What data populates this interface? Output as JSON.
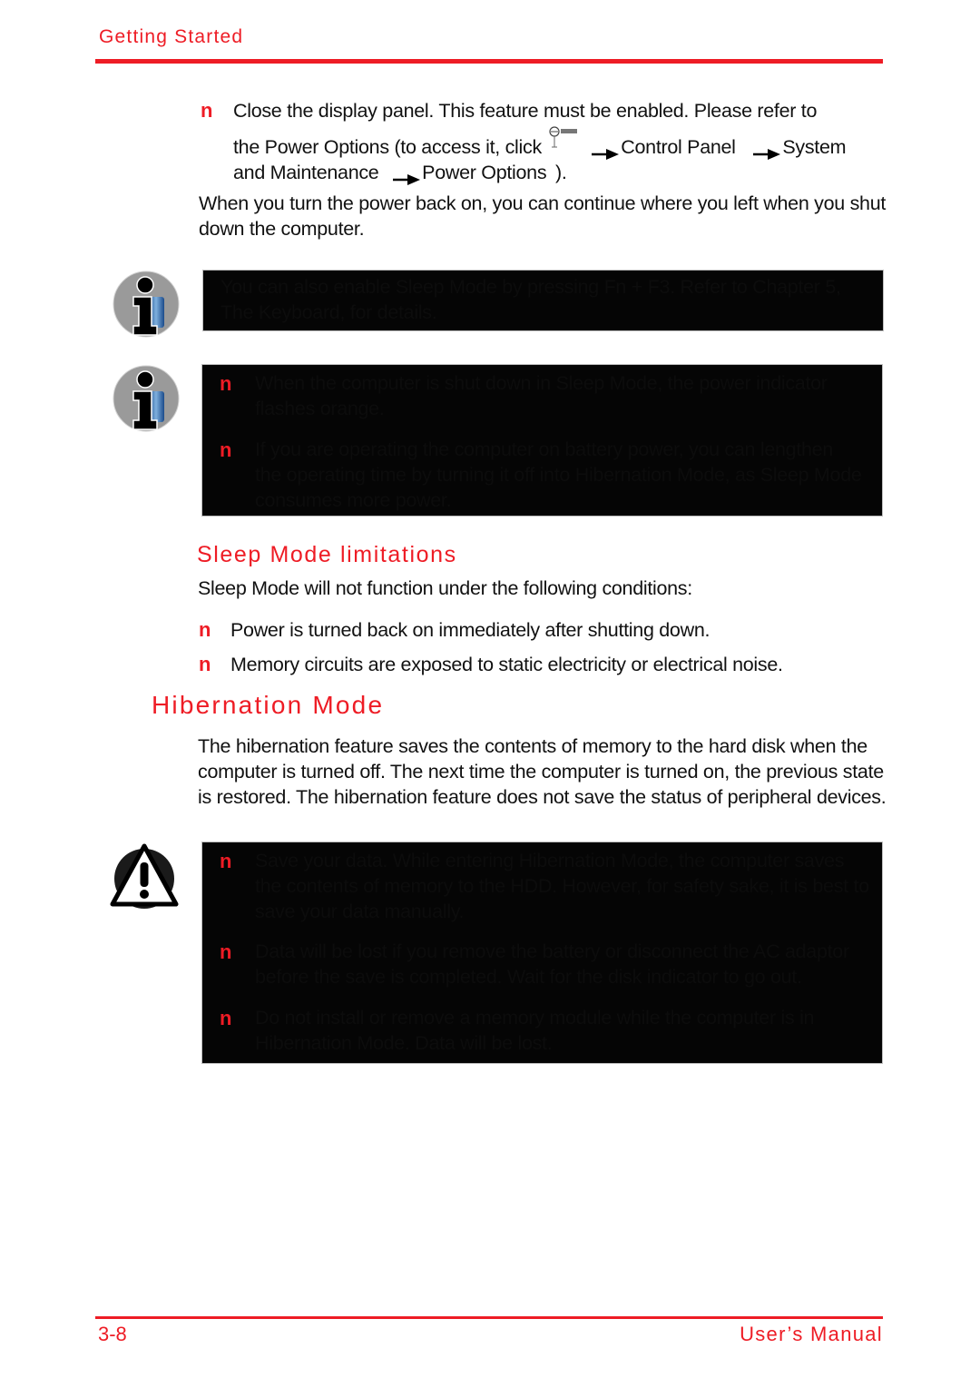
{
  "header": {
    "section_title": "Getting Started"
  },
  "top_bullet": {
    "line1": "Close the display panel. This feature must be enabled. Please refer to",
    "line2_prefix": "the Power Options (to access it, click",
    "start_icon": "windows-start-icon",
    "step1": "Control Panel",
    "step2": "System",
    "line3_prefix": "and Maintenance",
    "step3": "Power Options",
    "line3_suffix": ")."
  },
  "resume_paragraph": {
    "line1": "When you turn the power back on, you can continue where you left when you shut",
    "line2": "down the computer."
  },
  "note1": {
    "icon": "info-icon",
    "lines": [
      "You can also enable Sleep Mode by pressing Fn + F3. Refer to Chapter 5,",
      "The Keyboard, for details."
    ]
  },
  "note2": {
    "icon": "info-icon",
    "items": [
      {
        "lines": [
          "When the computer is shut down in Sleep Mode, the power indicator",
          "flashes orange."
        ]
      },
      {
        "lines": [
          "If you are operating the computer on battery power, you can lengthen",
          "the operating time by turning it off into Hibernation Mode, as Sleep Mode",
          "consumes more power."
        ]
      }
    ]
  },
  "sleep_limitations": {
    "heading": "Sleep Mode limitations",
    "intro": "Sleep Mode will not function under the following conditions:",
    "items": [
      "Power is turned back on immediately after shutting down.",
      "Memory circuits are exposed to static electricity or electrical noise."
    ]
  },
  "hibernation": {
    "heading": "Hibernation Mode",
    "lines": [
      "The hibernation feature saves the contents of memory to the hard disk when the",
      "computer is turned off. The next time the computer is turned on, the previous state",
      "is restored. The hibernation feature does not save the status of peripheral devices."
    ]
  },
  "caution": {
    "icon": "warning-icon",
    "items": [
      {
        "lines": [
          "Save your data. While entering Hibernation Mode, the computer saves",
          "the contents of memory to the HDD. However, for safety sake, it is best to",
          "save your data manually."
        ]
      },
      {
        "lines": [
          "Data will be lost if you remove the battery or disconnect the AC adaptor",
          "before the save is completed. Wait for the disk indicator to go out."
        ]
      },
      {
        "lines": [
          "Do not install or remove a memory module while the computer is in",
          "Hibernation Mode. Data will be lost."
        ]
      }
    ]
  },
  "bullet_glyph": "n",
  "footer": {
    "page_number": "3-8",
    "manual_title": "User’s Manual"
  },
  "colors": {
    "accent": "#ee1c25",
    "note_box": "#050505",
    "text": "#111111"
  }
}
